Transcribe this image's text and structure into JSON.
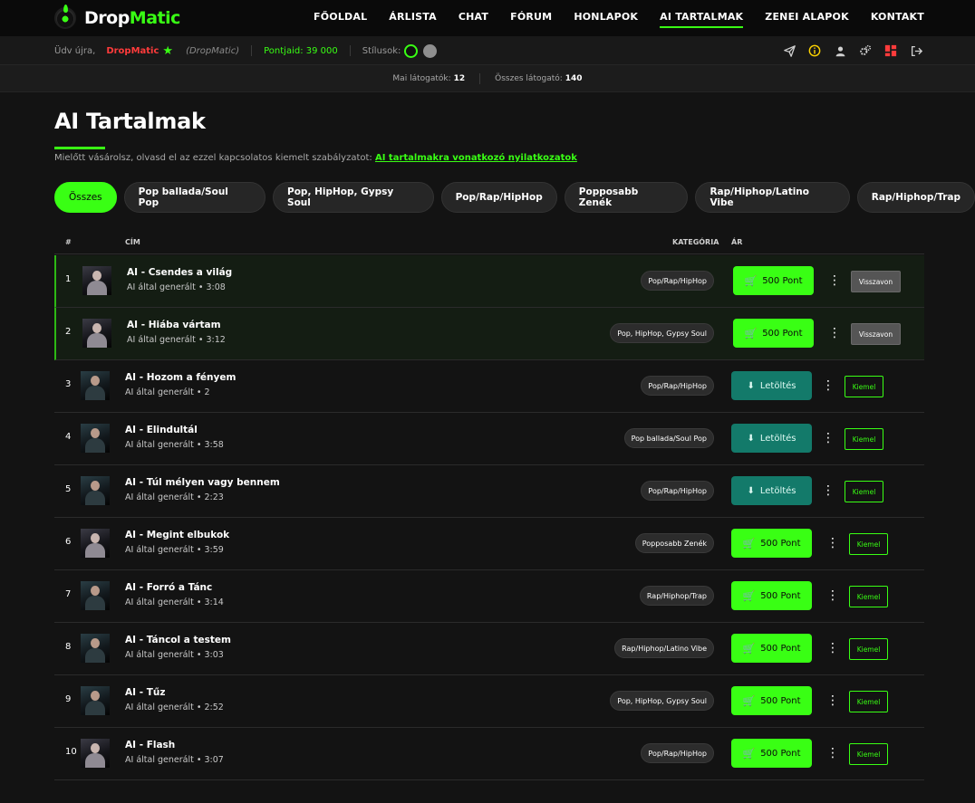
{
  "brand": {
    "name_part1": "Drop",
    "name_part2": "Matic"
  },
  "nav": {
    "items": [
      {
        "label": "FŐOLDAL",
        "active": false
      },
      {
        "label": "ÁRLISTA",
        "active": false
      },
      {
        "label": "CHAT",
        "active": false
      },
      {
        "label": "FÓRUM",
        "active": false
      },
      {
        "label": "HONLAPOK",
        "active": false
      },
      {
        "label": "AI TARTALMAK",
        "active": true
      },
      {
        "label": "ZENEI ALAPOK",
        "active": false
      },
      {
        "label": "KONTAKT",
        "active": false
      }
    ]
  },
  "userbar": {
    "welcome": "Üdv újra,",
    "username": "DropMatic",
    "alias": "(DropMatic)",
    "points": "Pontjaid: 39 000",
    "styles_label": "Stílusok:",
    "icons": [
      "send-icon",
      "info-icon",
      "user-icon",
      "settings-icon",
      "dashboard-icon",
      "logout-icon"
    ]
  },
  "stats": {
    "today_label": "Mai látogatók:",
    "today_value": "12",
    "total_label": "Összes látogató:",
    "total_value": "140"
  },
  "page": {
    "title": "AI Tartalmak",
    "notice_text": "Mielőtt vásárolsz, olvasd el az ezzel kapcsolatos kiemelt szabályzatot:",
    "notice_link": "AI tartalmakra vonatkozó nyilatkozatok"
  },
  "filters": [
    {
      "label": "Összes",
      "active": true
    },
    {
      "label": "Pop ballada/Soul Pop",
      "active": false
    },
    {
      "label": "Pop, HipHop, Gypsy Soul",
      "active": false
    },
    {
      "label": "Pop/Rap/HipHop",
      "active": false
    },
    {
      "label": "Popposabb Zenék",
      "active": false
    },
    {
      "label": "Rap/Hiphop/Latino Vibe",
      "active": false
    },
    {
      "label": "Rap/Hiphop/Trap",
      "active": false
    }
  ],
  "table": {
    "headers": {
      "num": "#",
      "title": "CÍM",
      "category": "KATEGÓRIA",
      "price": "ÁR"
    },
    "rows": [
      {
        "num": "1",
        "title": "AI - Csendes a világ",
        "sub": "AI által generált • 3:08",
        "category": "Pop/Rap/HipHop",
        "button": "500 Pont",
        "action": "Visszavon"
      },
      {
        "num": "2",
        "title": "AI - Hiába vártam",
        "sub": "AI által generált • 3:12",
        "category": "Pop, HipHop, Gypsy Soul",
        "button": "500 Pont",
        "action": "Visszavon"
      },
      {
        "num": "3",
        "title": "AI - Hozom a fényem",
        "sub": "AI által generált • 2",
        "category": "Pop/Rap/HipHop",
        "button": "Letöltés",
        "action": "Kiemel"
      },
      {
        "num": "4",
        "title": "AI - Elindultál",
        "sub": "AI által generált • 3:58",
        "category": "Pop ballada/Soul Pop",
        "button": "Letöltés",
        "action": "Kiemel"
      },
      {
        "num": "5",
        "title": "AI - Túl mélyen vagy bennem",
        "sub": "AI által generált • 2:23",
        "category": "Pop/Rap/HipHop",
        "button": "Letöltés",
        "action": "Kiemel"
      },
      {
        "num": "6",
        "title": "AI - Megint elbukok",
        "sub": "AI által generált • 3:59",
        "category": "Popposabb Zenék",
        "button": "500 Pont",
        "action": "Kiemel"
      },
      {
        "num": "7",
        "title": "AI - Forró a Tánc",
        "sub": "AI által generált • 3:14",
        "category": "Rap/Hiphop/Trap",
        "button": "500 Pont",
        "action": "Kiemel"
      },
      {
        "num": "8",
        "title": "AI - Táncol a testem",
        "sub": "AI által generált • 3:03",
        "category": "Rap/Hiphop/Latino Vibe",
        "button": "500 Pont",
        "action": "Kiemel"
      },
      {
        "num": "9",
        "title": "AI - Tűz",
        "sub": "AI által generált • 2:52",
        "category": "Pop, HipHop, Gypsy Soul",
        "button": "500 Pont",
        "action": "Kiemel"
      },
      {
        "num": "10",
        "title": "AI - Flash",
        "sub": "AI által generált • 3:07",
        "category": "Pop/Rap/HipHop",
        "button": "500 Pont",
        "action": "Kiemel"
      }
    ]
  },
  "colors": {
    "accent": "#39ff14",
    "download": "#137a6a",
    "username": "#ff3b3b"
  }
}
